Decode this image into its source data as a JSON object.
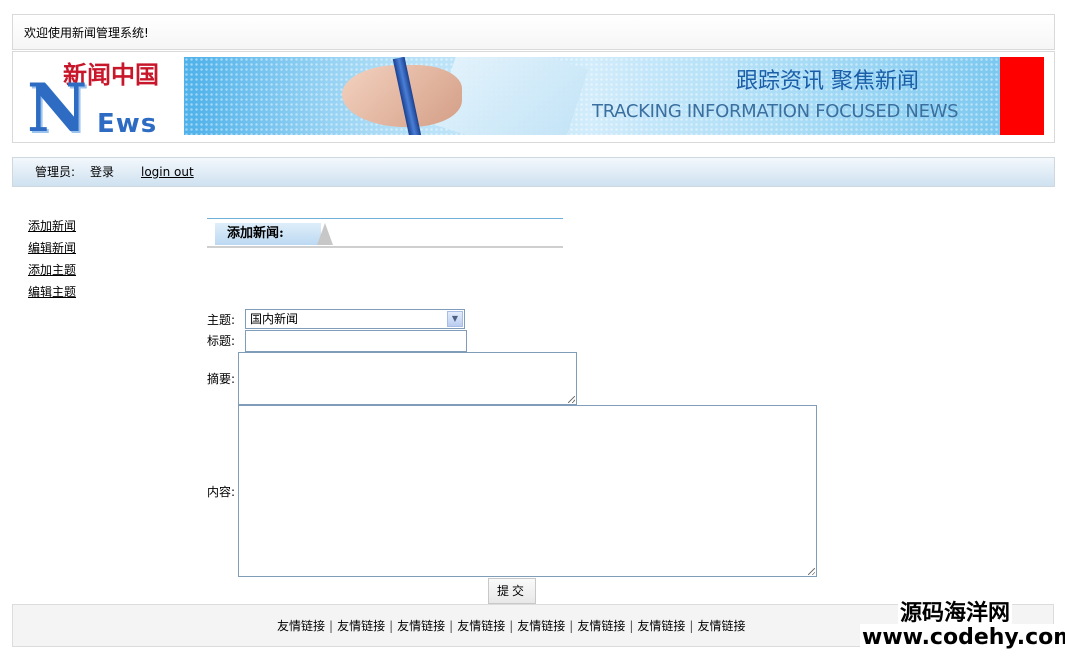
{
  "header": {
    "welcome_text": "欢迎使用新闻管理系统!"
  },
  "banner": {
    "logo_cn": "新闻中国",
    "logo_n": "N",
    "logo_ews": "Ews",
    "slogan_cn": "跟踪资讯 聚焦新闻",
    "slogan_en": "TRACKING INFORMATION FOCUSED NEWS",
    "accent_color": "#ff0000"
  },
  "adminbar": {
    "admin_label": "管理员:",
    "login_text": "登录",
    "logout_text": "login out"
  },
  "sidebar": {
    "items": [
      {
        "label": "添加新闻"
      },
      {
        "label": "编辑新闻"
      },
      {
        "label": "添加主题"
      },
      {
        "label": "编辑主题"
      }
    ]
  },
  "main": {
    "section_title": "添加新闻:",
    "form": {
      "topic_label": "主题:",
      "topic_selected": "国内新闻",
      "title_label": "标题:",
      "title_value": "",
      "summary_label": "摘要:",
      "summary_value": "",
      "content_label": "内容:",
      "content_value": "",
      "submit_label": "提交"
    }
  },
  "footer": {
    "links": [
      "友情链接",
      "友情链接",
      "友情链接",
      "友情链接",
      "友情链接",
      "友情链接",
      "友情链接",
      "友情链接"
    ],
    "separator": "|"
  },
  "watermark": {
    "cn": "源码海洋网",
    "url": "www.codehy.com"
  }
}
